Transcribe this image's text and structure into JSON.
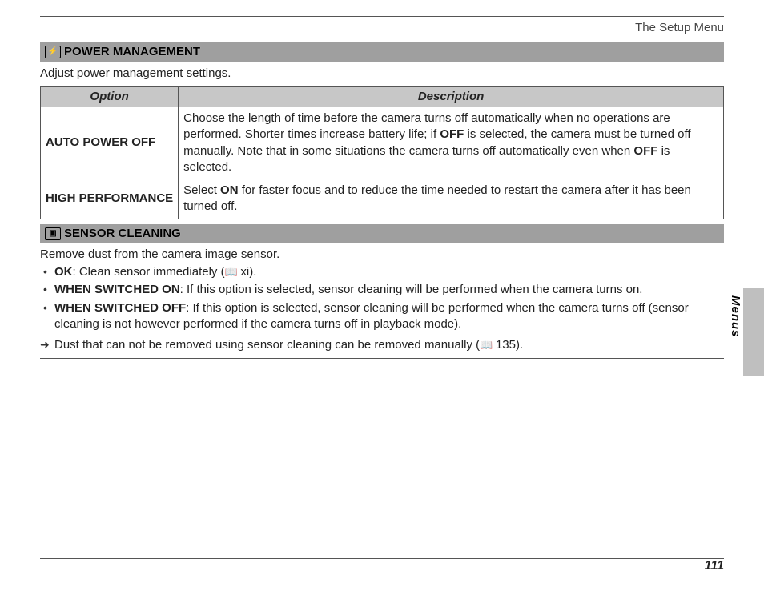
{
  "header": {
    "right_text": "The Setup Menu"
  },
  "side_tab": {
    "label": "Menus"
  },
  "page_number": "111",
  "power_mgmt": {
    "title": "POWER MANAGEMENT",
    "intro": "Adjust power management settings.",
    "table": {
      "headers": {
        "option": "Option",
        "description": "Description"
      },
      "rows": [
        {
          "name": "AUTO POWER OFF",
          "desc_pre": "Choose the length of time before the camera turns off automatically when no operations are performed. Shorter times increase battery life; if ",
          "desc_bold1": "OFF",
          "desc_mid": " is selected, the camera must be turned off manually. Note that in some situations the camera turns off automatically even when ",
          "desc_bold2": "OFF",
          "desc_post": " is selected."
        },
        {
          "name": "HIGH PERFORMANCE",
          "desc_pre": "Select ",
          "desc_bold1": "ON",
          "desc_mid": " for faster focus and to reduce the time needed to restart the camera after it has been turned off.",
          "desc_bold2": "",
          "desc_post": ""
        }
      ]
    }
  },
  "sensor_cleaning": {
    "title": "SENSOR CLEANING",
    "intro": "Remove dust from the camera image sensor.",
    "items": [
      {
        "bold": "OK",
        "text": ": Clean sensor immediately (",
        "ref": "xi",
        "tail": ")."
      },
      {
        "bold": "WHEN SWITCHED ON",
        "text": ": If this option is selected, sensor cleaning will be performed when the camera turns on.",
        "ref": "",
        "tail": ""
      },
      {
        "bold": "WHEN SWITCHED OFF",
        "text": ": If this option is selected, sensor cleaning will be performed when the camera turns off (sensor cleaning is not however performed if the camera turns off in playback mode).",
        "ref": "",
        "tail": ""
      }
    ],
    "note": {
      "text_pre": "Dust that can not be removed using sensor cleaning can be removed manually (",
      "ref": "135",
      "text_post": ")."
    }
  }
}
